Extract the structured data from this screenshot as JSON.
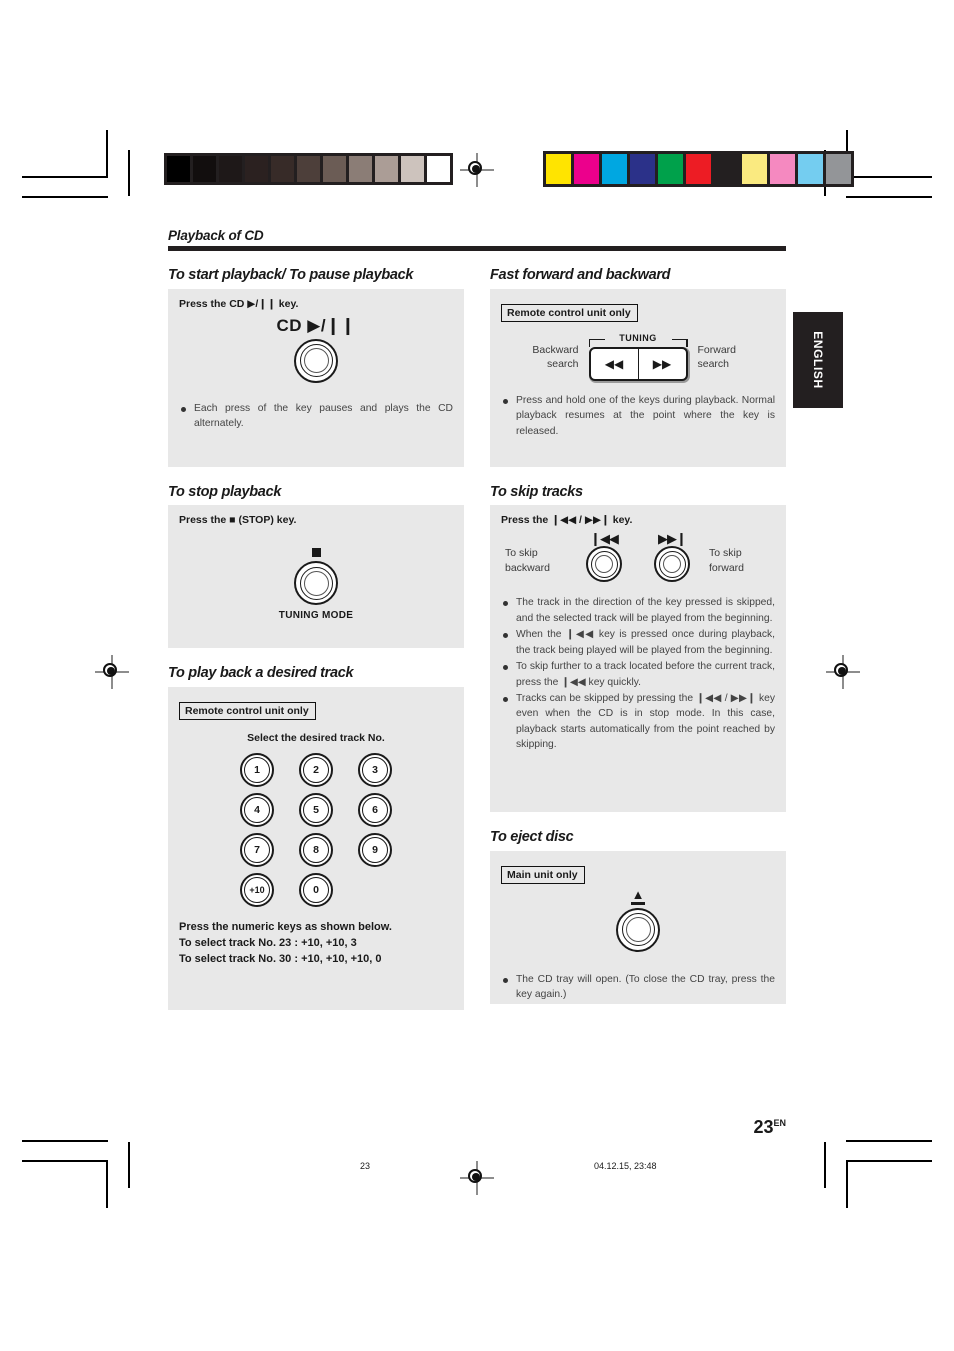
{
  "header": {
    "section_title": "Playback of CD",
    "language_tab": "ENGLISH"
  },
  "calibration": {
    "gray_steps": [
      "#000000",
      "#120e0e",
      "#1e1818",
      "#2b2120",
      "#372b28",
      "#4d3f3a",
      "#6b5c55",
      "#8b7d76",
      "#ab9d96",
      "#cdc3bd",
      "#ffffff"
    ],
    "color_steps": [
      "#ffe400",
      "#ec008c",
      "#00a7e1",
      "#2b3189",
      "#00a14b",
      "#ed1c24",
      "#231f20",
      "#faea80",
      "#f589c0",
      "#74cdf0",
      "#939598"
    ]
  },
  "left_column": {
    "start_pause": {
      "title": "To start playback/ To pause playback",
      "instruction": "Press the CD ▶/❙❙ key.",
      "button_label": "CD ▶/❙❙",
      "knob_name": "cd-play-pause-knob",
      "notes": [
        "Each press of the key pauses and plays the CD alternately."
      ]
    },
    "stop": {
      "title": "To stop playback",
      "instruction": "Press the ■ (STOP) key.",
      "knob_caption": "TUNING MODE",
      "knob_name": "stop-tuning-mode-knob"
    },
    "desired_track": {
      "title": "To play back a desired track",
      "badge": "Remote control unit only",
      "instruction": "Select the desired track No.",
      "keys": [
        "1",
        "2",
        "3",
        "4",
        "5",
        "6",
        "7",
        "8",
        "9",
        "+10",
        "0"
      ],
      "footnotes": [
        "Press the numeric keys as shown below.",
        "To select track No. 23 : +10, +10, 3",
        "To select track No. 30 : +10, +10, +10, 0"
      ]
    }
  },
  "right_column": {
    "fast_fwd_bwd": {
      "title": "Fast forward and backward",
      "badge": "Remote control unit only",
      "bracket_label": "TUNING",
      "left_label": "Backward\nsearch",
      "left_label_line1": "Backward",
      "left_label_line2": "search",
      "right_label_line1": "Forward",
      "right_label_line2": "search",
      "button_backward_glyph": "◀◀",
      "button_forward_glyph": "▶▶",
      "notes": [
        "Press and hold one of the keys during playback. Normal playback resumes at the point where the key is released."
      ]
    },
    "skip_tracks": {
      "title": "To skip tracks",
      "instruction": "Press the ❙◀◀ / ▶▶❙ key.",
      "left_label_line1": "To skip",
      "left_label_line2": "backward",
      "right_label_line1": "To skip",
      "right_label_line2": "forward",
      "backward_glyph": "❙◀◀",
      "forward_glyph": "▶▶❙",
      "notes": [
        "The track in the direction of the key pressed is skipped, and the selected track will be played from the beginning.",
        "When the ❙◀◀ key is pressed once during playback, the track being played will be played from the beginning.",
        "To skip further to a track located before the current track, press the ❙◀◀ key quickly.",
        "Tracks can be skipped by pressing the ❙◀◀ / ▶▶❙ key even when the CD is in stop mode. In this case, playback starts automatically from the point reached by skipping."
      ]
    },
    "eject": {
      "title": "To eject disc",
      "badge": "Main unit only",
      "eject_glyph": "▲",
      "notes": [
        "The CD tray will open. (To close the CD tray, press the key again.)"
      ]
    }
  },
  "footer": {
    "page_number": "23",
    "page_suffix": "EN",
    "sheet_number": "23",
    "timestamp": "04.12.15, 23:48"
  }
}
